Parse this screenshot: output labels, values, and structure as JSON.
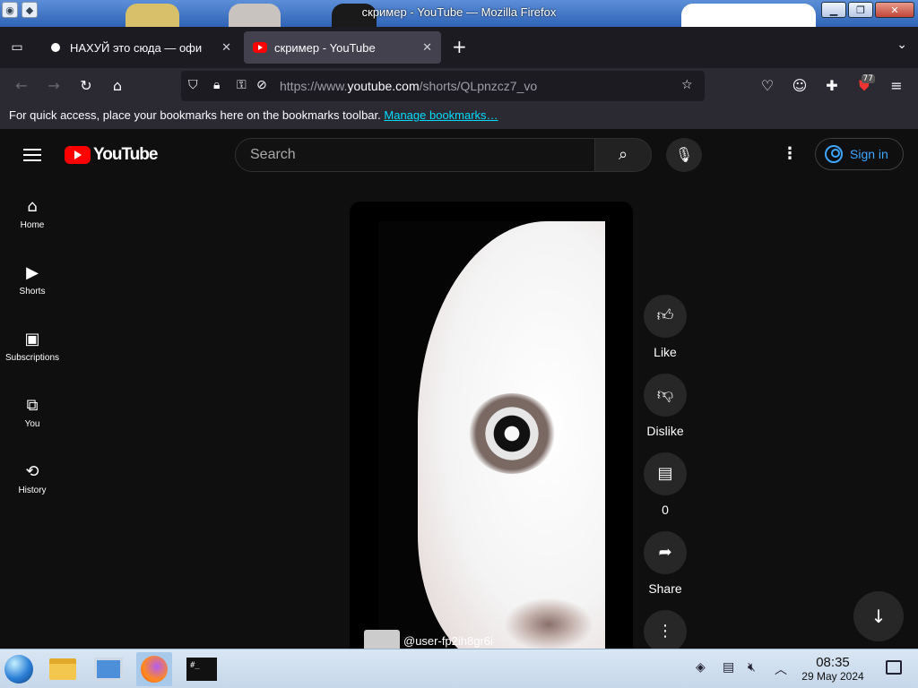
{
  "window": {
    "title": "скример - YouTube — Mozilla Firefox"
  },
  "tabs": [
    {
      "label": "НАХУЙ это сюда — офи",
      "active": false
    },
    {
      "label": "скример - YouTube",
      "active": true
    }
  ],
  "navbar": {
    "url_prefix": "https://www.",
    "url_domain": "youtube.com",
    "url_path": "/shorts/QLpnzcz7_vo",
    "extension_badge": "77"
  },
  "bookmarks_bar": {
    "message": "For quick access, place your bookmarks here on the bookmarks toolbar.",
    "link": "Manage bookmarks…"
  },
  "youtube": {
    "logo_text": "YouTube",
    "search_placeholder": "Search",
    "sign_in": "Sign in",
    "sidebar": [
      {
        "label": "Home",
        "icon": "home-icon"
      },
      {
        "label": "Shorts",
        "icon": "shorts-icon"
      },
      {
        "label": "Subscriptions",
        "icon": "subscriptions-icon"
      },
      {
        "label": "You",
        "icon": "you-icon"
      },
      {
        "label": "History",
        "icon": "history-icon"
      }
    ],
    "short": {
      "channel": "@user-fp2ih8gr6i"
    },
    "actions": {
      "like": "Like",
      "dislike": "Dislike",
      "comments": "0",
      "share": "Share"
    }
  },
  "taskbar": {
    "time": "08:35",
    "date": "29 May 2024"
  },
  "colors": {
    "youtube_red": "#ff0000",
    "signin_blue": "#3ea6ff",
    "firefox_dark": "#1c1b22"
  }
}
